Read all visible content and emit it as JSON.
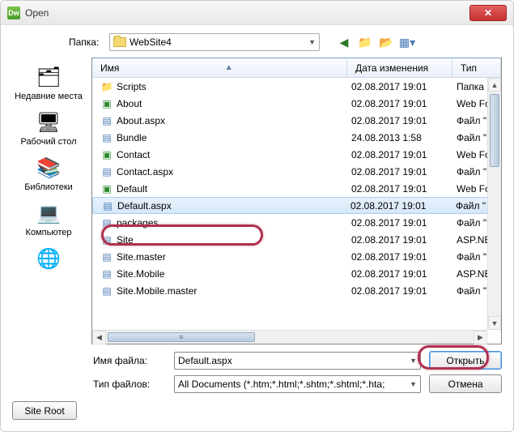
{
  "titlebar": {
    "app_icon_text": "Dw",
    "title": "Open"
  },
  "folder_row": {
    "label": "Папка:",
    "current": "WebSite4"
  },
  "sidebar": {
    "items": [
      {
        "label": "Недавние места",
        "glyph": "🗂"
      },
      {
        "label": "Рабочий стол",
        "glyph": "🖥"
      },
      {
        "label": "Библиотеки",
        "glyph": "📚"
      },
      {
        "label": "Компьютер",
        "glyph": "💻"
      },
      {
        "label": "",
        "glyph": "🌐"
      }
    ]
  },
  "columns": {
    "name": "Имя",
    "date": "Дата изменения",
    "type": "Тип"
  },
  "files": [
    {
      "name": "Scripts",
      "date": "02.08.2017 19:01",
      "type": "Папка",
      "icon": "folder"
    },
    {
      "name": "About",
      "date": "02.08.2017 19:01",
      "type": "Web Fо",
      "icon": "webf"
    },
    {
      "name": "About.aspx",
      "date": "02.08.2017 19:01",
      "type": "Файл \"",
      "icon": "file"
    },
    {
      "name": "Bundle",
      "date": "24.08.2013 1:58",
      "type": "Файл \"",
      "icon": "file"
    },
    {
      "name": "Contact",
      "date": "02.08.2017 19:01",
      "type": "Web Fо",
      "icon": "webf"
    },
    {
      "name": "Contact.aspx",
      "date": "02.08.2017 19:01",
      "type": "Файл \"",
      "icon": "file"
    },
    {
      "name": "Default",
      "date": "02.08.2017 19:01",
      "type": "Web Fо",
      "icon": "webf"
    },
    {
      "name": "Default.aspx",
      "date": "02.08.2017 19:01",
      "type": "Файл \"",
      "icon": "file",
      "selected": true
    },
    {
      "name": "packages",
      "date": "02.08.2017 19:01",
      "type": "Файл \"",
      "icon": "file"
    },
    {
      "name": "Site",
      "date": "02.08.2017 19:01",
      "type": "ASP.NE",
      "icon": "file"
    },
    {
      "name": "Site.master",
      "date": "02.08.2017 19:01",
      "type": "Файл \"",
      "icon": "file"
    },
    {
      "name": "Site.Mobile",
      "date": "02.08.2017 19:01",
      "type": "ASP.NE",
      "icon": "file"
    },
    {
      "name": "Site.Mobile.master",
      "date": "02.08.2017 19:01",
      "type": "Файл \"",
      "icon": "file"
    }
  ],
  "form": {
    "filename_label": "Имя файла:",
    "filename_value": "Default.aspx",
    "filetype_label": "Тип файлов:",
    "filetype_value": "All Documents (*.htm;*.html;*.shtm;*.shtml;*.hta;",
    "open_btn": "Открыть",
    "cancel_btn": "Отмена"
  },
  "site_root_btn": "Site Root",
  "hscroll_grip": "≡"
}
